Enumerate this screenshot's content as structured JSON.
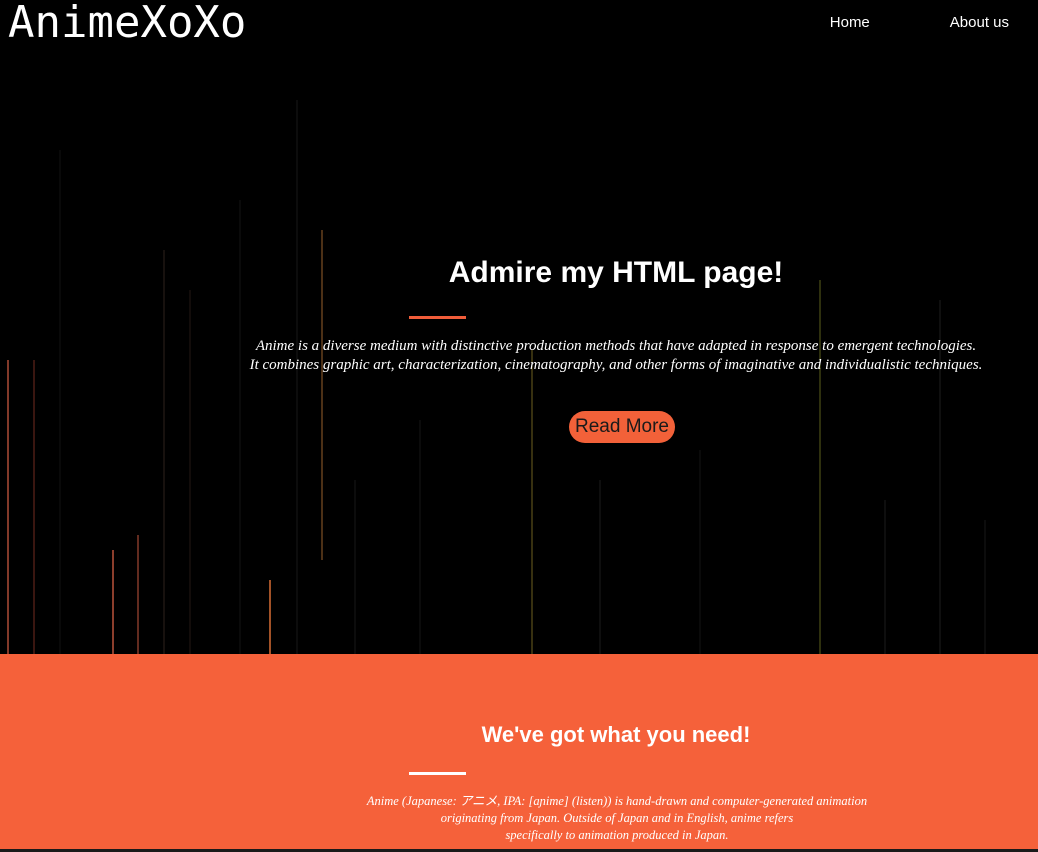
{
  "brand": {
    "title": "AnimeXoXo"
  },
  "nav": {
    "items": [
      {
        "label": "Home"
      },
      {
        "label": "About us"
      }
    ]
  },
  "hero": {
    "title": "Admire my HTML page!",
    "text_line1": "Anime is a diverse medium with distinctive production methods that have adapted in response to emergent technologies.",
    "text_line2": "It combines graphic art, characterization, cinematography, and other forms of imaginative and individualistic techniques.",
    "button_label": "Read More",
    "background": "dark-with-vertical-light-streaks"
  },
  "band": {
    "title": "We've got what you need!",
    "text_line1": "Anime (Japanese: アニメ, IPA: [aɲime] (listen)) is hand-drawn and computer-generated animation",
    "text_line2": "originating from Japan. Outside of Japan and in English, anime refers",
    "text_line3": "specifically to animation produced in Japan."
  },
  "colors": {
    "accent": "#f5613a",
    "hero_bg": "#000000",
    "text": "#ffffff"
  }
}
